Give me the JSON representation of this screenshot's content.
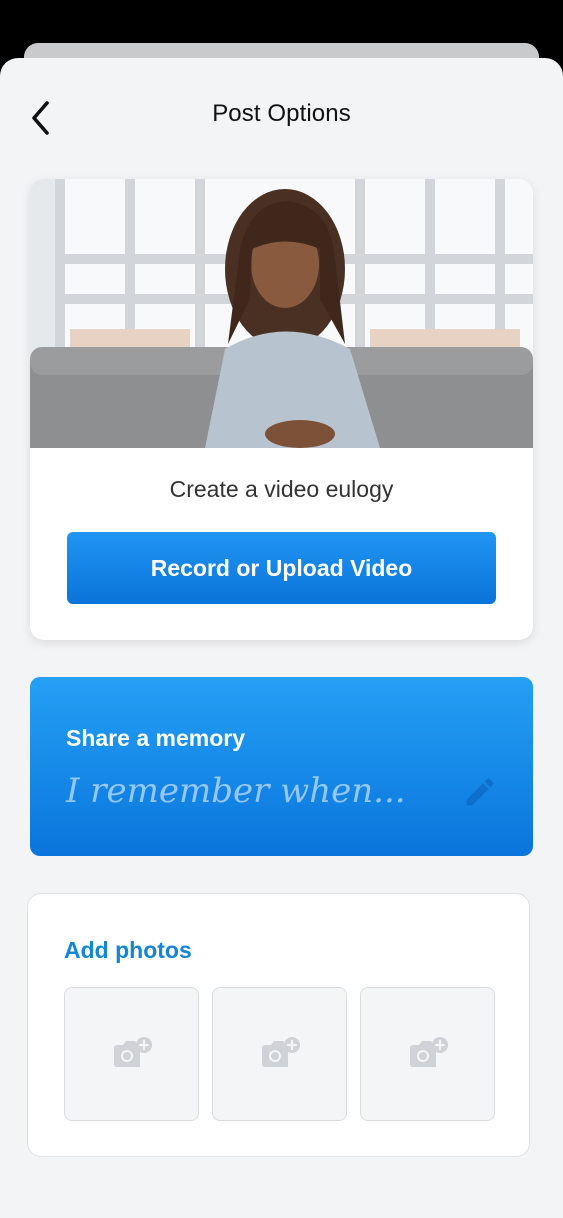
{
  "header": {
    "title": "Post Options",
    "back_icon": "chevron-left-icon"
  },
  "video": {
    "caption": "Create a video eulogy",
    "button_label": "Record or Upload Video"
  },
  "memory": {
    "title": "Share a memory",
    "placeholder": "I remember when...",
    "icon": "pencil-icon"
  },
  "photos": {
    "title": "Add photos",
    "slots": [
      {
        "icon": "add-photo-icon"
      },
      {
        "icon": "add-photo-icon"
      },
      {
        "icon": "add-photo-icon"
      }
    ]
  },
  "colors": {
    "primary_blue": "#0a73d9",
    "accent_blue": "#1585d6",
    "sheet_background": "#f3f4f6"
  }
}
